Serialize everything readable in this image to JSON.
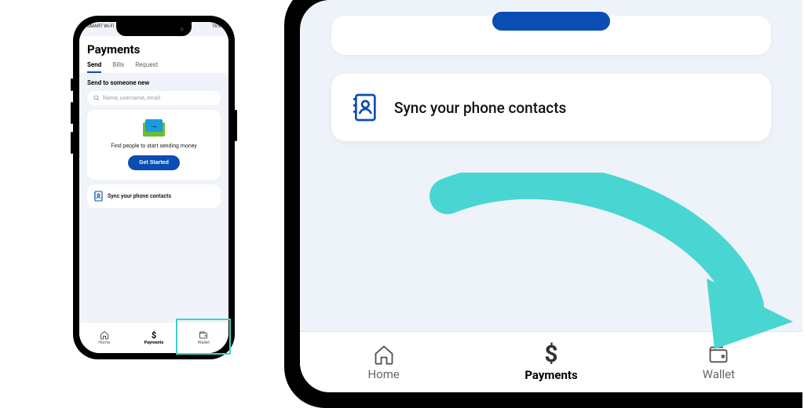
{
  "status": {
    "left": "SMART Wi-Fi",
    "right": "76%"
  },
  "header": {
    "title": "Payments"
  },
  "tabs": [
    "Send",
    "Bills",
    "Request"
  ],
  "active_tab_index": 0,
  "send": {
    "subhead": "Send to someone new",
    "search_placeholder": "Name, username, email",
    "card_text": "Find people to start sending money",
    "cta": "Get Started",
    "sync_label": "Sync your phone contacts"
  },
  "nav": [
    {
      "label": "Home",
      "icon": "home"
    },
    {
      "label": "Payments",
      "icon": "dollar"
    },
    {
      "label": "Wallet",
      "icon": "wallet"
    }
  ],
  "active_nav_index": 1,
  "colors": {
    "accent": "#0a4db3",
    "highlight": "#3fd0cf"
  }
}
